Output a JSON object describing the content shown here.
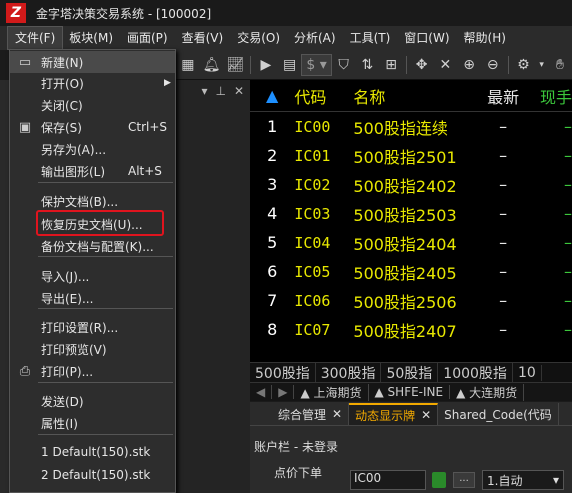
{
  "window": {
    "title": "金字塔决策交易系统 - [100002]"
  },
  "menubar": [
    {
      "label": "文件(F)",
      "active": true
    },
    {
      "label": "板块(M)"
    },
    {
      "label": "画面(P)"
    },
    {
      "label": "查看(V)"
    },
    {
      "label": "交易(O)"
    },
    {
      "label": "分析(A)"
    },
    {
      "label": "工具(T)"
    },
    {
      "label": "窗口(W)"
    },
    {
      "label": "帮助(H)"
    }
  ],
  "toolbar": {
    "currency_label": "$"
  },
  "file_menu": {
    "items": [
      {
        "label": "新建(N)",
        "shortcut": "",
        "highlight": true
      },
      {
        "label": "打开(O)",
        "shortcut": "",
        "submenu": true
      },
      {
        "label": "关闭(C)",
        "shortcut": ""
      },
      {
        "label": "保存(S)",
        "shortcut": "Ctrl+S"
      },
      {
        "label": "另存为(A)...",
        "shortcut": ""
      },
      {
        "label": "输出图形(L)",
        "shortcut": "Alt+S"
      },
      {
        "label": "保护文档(B)...",
        "shortcut": ""
      },
      {
        "label": "恢复历史文档(U)...",
        "shortcut": ""
      },
      {
        "label": "备份文档与配置(K)...",
        "shortcut": ""
      },
      {
        "label": "导入(J)...",
        "shortcut": ""
      },
      {
        "label": "导出(E)...",
        "shortcut": ""
      },
      {
        "label": "打印设置(R)...",
        "shortcut": ""
      },
      {
        "label": "打印预览(V)",
        "shortcut": ""
      },
      {
        "label": "打印(P)...",
        "shortcut": ""
      },
      {
        "label": "发送(D)",
        "shortcut": ""
      },
      {
        "label": "属性(I)",
        "shortcut": ""
      },
      {
        "label": "1 Default(150).stk",
        "shortcut": ""
      },
      {
        "label": "2 Default(150).stk",
        "shortcut": ""
      }
    ]
  },
  "quote_table": {
    "headers": {
      "code": "代码",
      "name": "名称",
      "last": "最新",
      "vol": "现手"
    },
    "rows": [
      {
        "idx": "1",
        "code": "IC00",
        "name": "500股指连续",
        "last": "–",
        "vol": "–"
      },
      {
        "idx": "2",
        "code": "IC01",
        "name": "500股指2501",
        "last": "–",
        "vol": "–"
      },
      {
        "idx": "3",
        "code": "IC02",
        "name": "500股指2402",
        "last": "–",
        "vol": "–"
      },
      {
        "idx": "4",
        "code": "IC03",
        "name": "500股指2503",
        "last": "–",
        "vol": "–"
      },
      {
        "idx": "5",
        "code": "IC04",
        "name": "500股指2404",
        "last": "–",
        "vol": "–"
      },
      {
        "idx": "6",
        "code": "IC05",
        "name": "500股指2405",
        "last": "–",
        "vol": "–"
      },
      {
        "idx": "7",
        "code": "IC06",
        "name": "500股指2506",
        "last": "–",
        "vol": "–"
      },
      {
        "idx": "8",
        "code": "IC07",
        "name": "500股指2407",
        "last": "–",
        "vol": "–"
      }
    ]
  },
  "index_strip": [
    "500股指",
    "300股指",
    "50股指",
    "1000股指",
    "10"
  ],
  "exchange_strip": [
    "▲ 上海期货",
    "▲ SHFE-INE",
    "▲ 大连期货"
  ],
  "bottom_tabs": [
    {
      "label": "综合管理",
      "active": false
    },
    {
      "label": "动态显示牌",
      "active": true
    },
    {
      "label": "Shared_Code(代码",
      "active": false
    }
  ],
  "account": {
    "title": "账户栏 - 未登录",
    "order_label": "点价下单",
    "order_code": "IC00",
    "mode": "1.自动"
  }
}
